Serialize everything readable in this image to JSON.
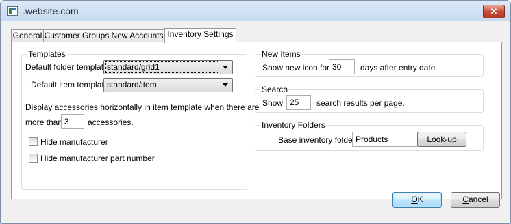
{
  "window": {
    "title": ".website.com",
    "close_glyph": "✕",
    "icon": "website-app-icon"
  },
  "tabs": [
    {
      "label": "General",
      "active": false
    },
    {
      "label": "Customer Groups",
      "active": false
    },
    {
      "label": "New Accounts",
      "active": false
    },
    {
      "label": "Inventory Settings",
      "active": true
    }
  ],
  "templates": {
    "legend": "Templates",
    "default_folder_label": "Default folder template:",
    "default_folder_value": "standard/grid1",
    "default_item_label": "Default item template:",
    "default_item_value": "standard/item",
    "accessories_line1": "Display accessories horizontally in item template when there are",
    "accessories_prefix": "more than",
    "accessories_value": "3",
    "accessories_suffix": "accessories.",
    "hide_manufacturer_label": "Hide manufacturer",
    "hide_manufacturer_checked": false,
    "hide_part_number_label": "Hide manufacturer part number",
    "hide_part_number_checked": false
  },
  "new_items": {
    "legend": "New Items",
    "prefix": "Show new icon for",
    "days_value": "30",
    "suffix": "days after entry date."
  },
  "search": {
    "legend": "Search",
    "prefix": "Show",
    "results_value": "25",
    "suffix": "search results per page."
  },
  "inventory_folders": {
    "legend": "Inventory Folders",
    "base_label": "Base inventory folder:",
    "base_value": "Products",
    "lookup_label": "Look-up"
  },
  "footer": {
    "ok_label": "OK",
    "ok_mnemonic": "O",
    "ok_rest": "K",
    "cancel_label": "Cancel",
    "cancel_mnemonic": "C",
    "cancel_rest": "ancel"
  }
}
